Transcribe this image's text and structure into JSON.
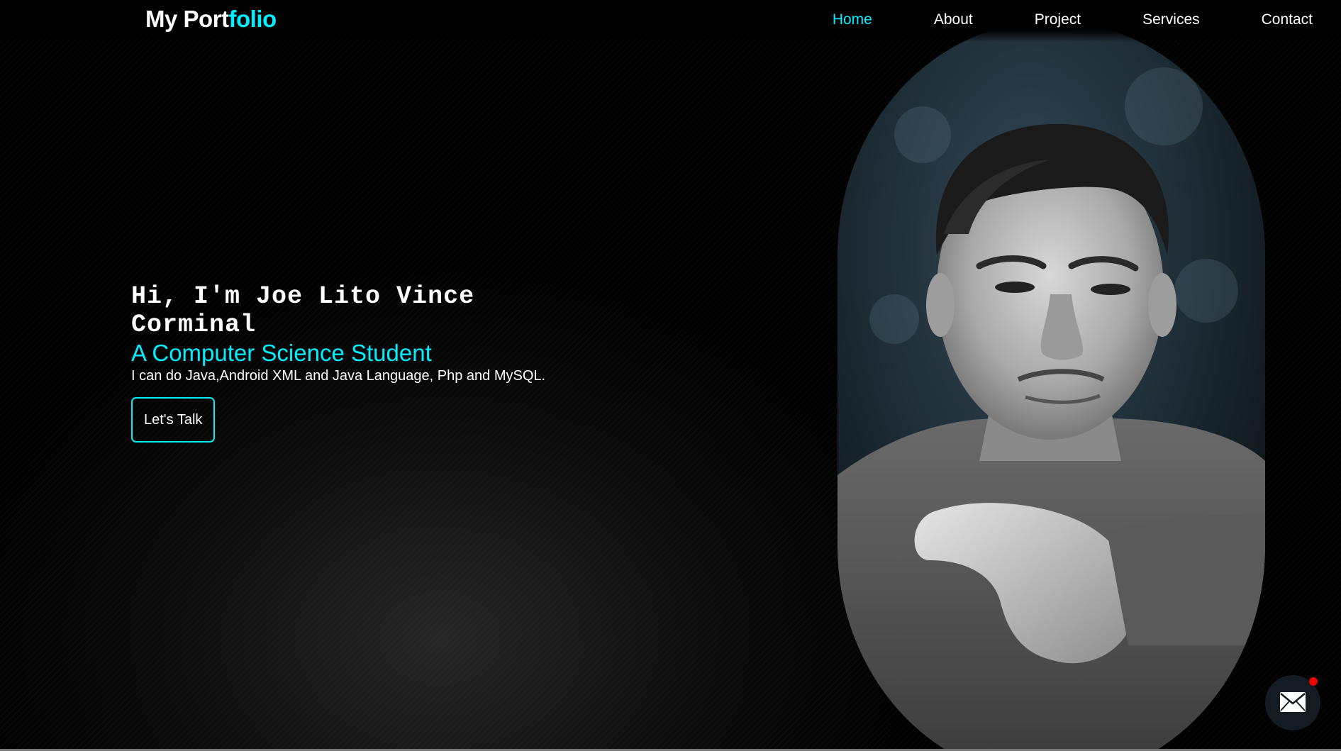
{
  "header": {
    "logo_main": "My Port",
    "logo_accent": "folio",
    "nav": [
      {
        "label": "Home",
        "active": true
      },
      {
        "label": "About",
        "active": false
      },
      {
        "label": "Project",
        "active": false
      },
      {
        "label": "Services",
        "active": false
      },
      {
        "label": "Contact",
        "active": false
      }
    ]
  },
  "hero": {
    "greeting": "Hi, I'm Joe Lito Vince Corminal",
    "subtitle": "A Computer Science Student",
    "description": "I can do Java,Android XML and Java Language, Php and MySQL.",
    "cta_label": "Let's Talk"
  },
  "portrait": {
    "icon": "profile-photo"
  },
  "mail_button": {
    "icon": "envelope-icon",
    "notification": true
  },
  "colors": {
    "accent": "#00eeff",
    "background": "#000000",
    "notification": "#ee0000"
  }
}
